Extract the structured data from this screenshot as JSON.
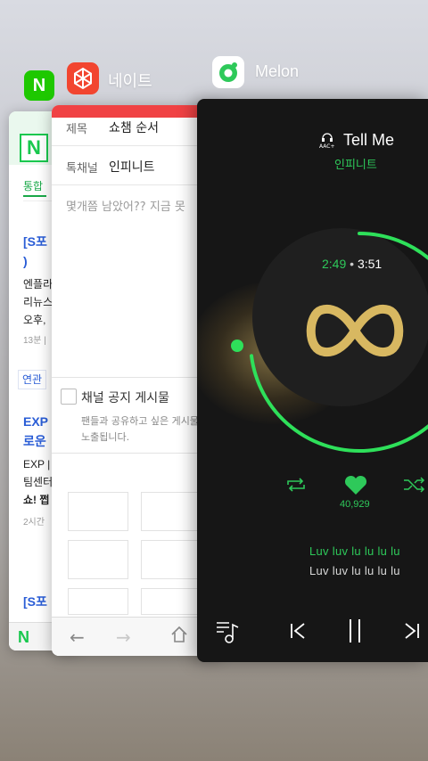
{
  "apps": {
    "naver": {
      "icon_name": "naver-icon",
      "icon_letter": "N",
      "tab": "통합",
      "news": [
        {
          "title": "[S포",
          "title2": ")",
          "body": [
            "엔플라",
            "리뉴스",
            "오후,"
          ],
          "meta": "13분 |"
        },
        {
          "title": "EXP",
          "title2": "로운",
          "body": [
            "EXP |",
            "팀센터",
            "쇼! 쩝"
          ],
          "meta": "2시간"
        },
        {
          "title": "[S포"
        }
      ],
      "related": "연관",
      "bottom_logo": "N"
    },
    "nate": {
      "icon_name": "nate-icon",
      "name": "네이트",
      "fields": [
        {
          "label": "제목",
          "value": "쇼챔 순서"
        },
        {
          "label": "톡채널",
          "value": "인피니트"
        }
      ],
      "body_text": "몇개쯤 남았어?? 지금 못",
      "notice_checkbox_label": "채널 공지 게시물",
      "notice_text": [
        "팬들과 공유하고 싶은 게시물을",
        "노출됩니다."
      ]
    },
    "melon": {
      "icon_name": "melon-icon",
      "name": "Melon",
      "song_title": "Tell Me",
      "artist": "인피니트",
      "aac_label": "AAC+",
      "current_time": "2:49",
      "time_sep": "•",
      "total_time": "3:51",
      "progress": 0.73,
      "like_count": "40,929",
      "lyrics": [
        "Luv luv lu lu lu lu",
        "Luv luv lu lu lu lu"
      ],
      "accent": "#2ec95a"
    }
  }
}
